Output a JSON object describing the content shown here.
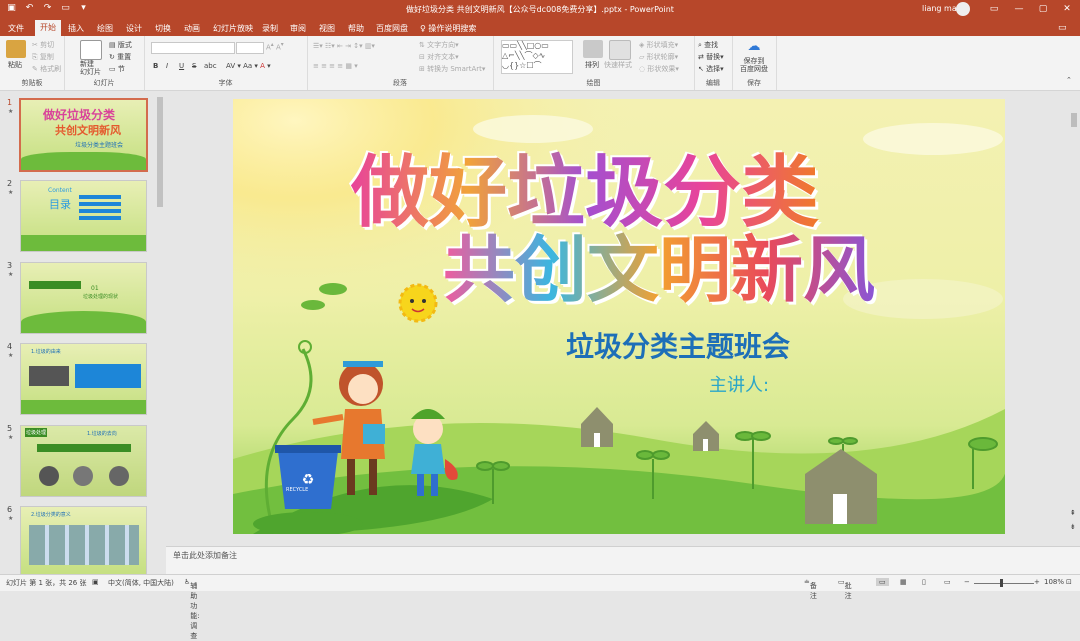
{
  "titlebar": {
    "doc_title": "做好垃圾分类 共创文明新风【公众号dc008免费分享】.pptx - PowerPoint",
    "user": "liang ma",
    "save_icon": "save-icon",
    "undo_icon": "undo-icon",
    "redo_icon": "redo-icon"
  },
  "tabs": [
    "文件",
    "开始",
    "插入",
    "绘图",
    "设计",
    "切换",
    "动画",
    "幻灯片放映",
    "录制",
    "审阅",
    "视图",
    "帮助",
    "百度网盘"
  ],
  "active_tab": "开始",
  "tell_me": "操作说明搜索",
  "ribbon": {
    "clipboard": {
      "paste": "粘贴",
      "cut": "剪切",
      "copy": "复制",
      "format_painter": "格式刷",
      "label": "剪贴板"
    },
    "slides": {
      "new_slide": "新建\n幻灯片",
      "layout": "版式",
      "reset": "重置",
      "section": "节",
      "label": "幻灯片"
    },
    "font": {
      "label": "字体",
      "bold": "B",
      "italic": "I",
      "underline": "U",
      "strike": "S",
      "shadow": "abc"
    },
    "paragraph": {
      "label": "段落",
      "text_direction": "文字方向",
      "align_text": "对齐文本",
      "smartart": "转换为 SmartArt"
    },
    "drawing": {
      "arrange": "排列",
      "quick_styles": "快速样式",
      "fill": "形状填充",
      "outline": "形状轮廓",
      "effects": "形状效果",
      "label": "绘图"
    },
    "editing": {
      "find": "查找",
      "replace": "替换",
      "select": "选择",
      "label": "编辑"
    },
    "save": {
      "save_to": "保存到\n百度网盘",
      "label": "保存"
    }
  },
  "thumbnails": [
    {
      "num": "1",
      "title": "做好垃圾分类",
      "subtitle": "共创文明新风",
      "caption": "垃圾分类主题班会"
    },
    {
      "num": "2",
      "title": "目录",
      "subtitle": "Content",
      "caption": ""
    },
    {
      "num": "3",
      "title": "01",
      "subtitle": "垃圾处理的现状",
      "caption": ""
    },
    {
      "num": "4",
      "title": "1.垃圾的由来",
      "subtitle": "",
      "caption": ""
    },
    {
      "num": "5",
      "title": "垃圾处理",
      "subtitle": "1.垃圾的去向",
      "caption": ""
    },
    {
      "num": "6",
      "title": "2.垃圾分类的意义",
      "subtitle": "",
      "caption": ""
    }
  ],
  "slide": {
    "title_line1": "做好垃圾分类",
    "title_line2": "共创文明新风",
    "subtitle": "垃圾分类主题班会",
    "presenter": "主讲人:",
    "bin_label": "RECYCLE"
  },
  "notes_placeholder": "单击此处添加备注",
  "status": {
    "slide_info": "幻灯片 第 1 张，共 26 张",
    "language": "中文(简体, 中国大陆)",
    "accessibility": "辅助功能: 调查",
    "notes_btn": "备注",
    "comments_btn": "批注",
    "zoom": "108%"
  },
  "colors": {
    "accent": "#b7472a",
    "ribbon": "#f3f3f3",
    "slide_title": "#1d6fb8"
  }
}
